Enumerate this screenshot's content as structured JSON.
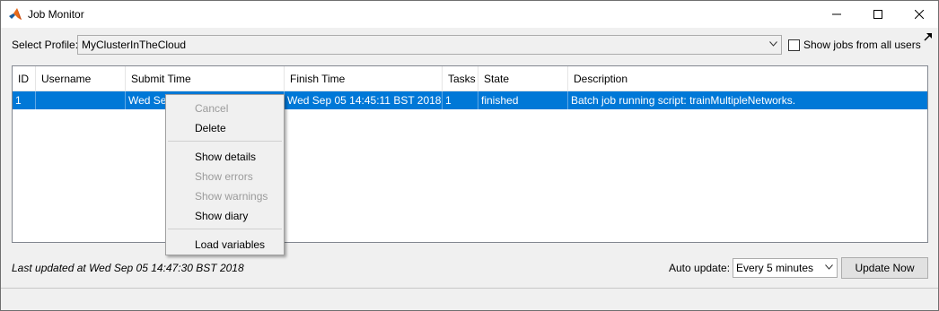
{
  "window": {
    "title": "Job Monitor",
    "controls": [
      "minimize",
      "maximize",
      "close"
    ]
  },
  "profile": {
    "label": "Select Profile:",
    "selected": "MyClusterInTheCloud",
    "show_all_label": "Show jobs from all users",
    "show_all_checked": false
  },
  "table": {
    "columns": [
      "ID",
      "Username",
      "Submit Time",
      "Finish Time",
      "Tasks",
      "State",
      "Description"
    ],
    "rows": [
      {
        "id": "1",
        "username": "",
        "submit_time": "Wed Sep",
        "finish_time": "Wed Sep 05 14:45:11 BST 2018",
        "tasks": "1",
        "state": "finished",
        "description": "Batch job running script: trainMultipleNetworks.",
        "selected": true
      }
    ]
  },
  "context_menu": {
    "items": [
      {
        "label": "Cancel",
        "enabled": false
      },
      {
        "label": "Delete",
        "enabled": true
      },
      {
        "label": "Show details",
        "enabled": true
      },
      {
        "label": "Show errors",
        "enabled": false
      },
      {
        "label": "Show warnings",
        "enabled": false
      },
      {
        "label": "Show diary",
        "enabled": true
      },
      {
        "label": "Load variables",
        "enabled": true
      }
    ]
  },
  "footer": {
    "last_updated": "Last updated at Wed Sep 05 14:47:30 BST 2018",
    "auto_update_label": "Auto update:",
    "auto_update_value": "Every 5 minutes",
    "update_button": "Update Now"
  },
  "colors": {
    "selection": "#0078d7",
    "window_bg": "#f0f0f0",
    "disabled_text": "#9b9b9b"
  },
  "icons": [
    "matlab-logo-icon",
    "minimize-icon",
    "maximize-icon",
    "close-icon",
    "undock-arrow-icon",
    "chevron-down-icon"
  ]
}
